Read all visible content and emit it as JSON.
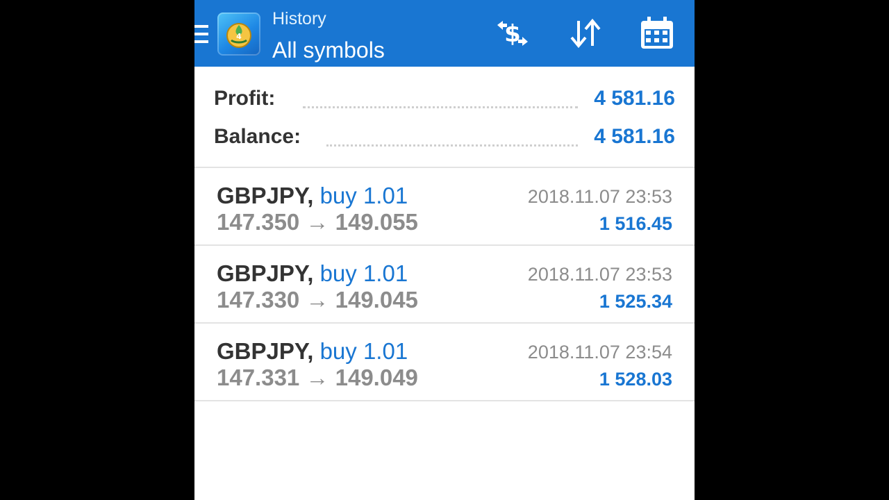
{
  "header": {
    "subtitle": "History",
    "title": "All symbols",
    "background_color": "#1976d2",
    "actions": [
      {
        "icon": "currency-exchange-icon"
      },
      {
        "icon": "sort-icon"
      },
      {
        "icon": "calendar-icon"
      }
    ]
  },
  "summary": {
    "profit_label": "Profit:",
    "profit_value": "4 581.16",
    "balance_label": "Balance:",
    "balance_value": "4 581.16"
  },
  "deals": [
    {
      "symbol": "GBPJPY",
      "separator": ",",
      "type": "buy 1.01",
      "prices": "147.350 → 149.055",
      "time": "2018.11.07 23:53",
      "profit": "1 516.45"
    },
    {
      "symbol": "GBPJPY",
      "separator": ",",
      "type": "buy 1.01",
      "prices": "147.330 → 149.045",
      "time": "2018.11.07 23:53",
      "profit": "1 525.34"
    },
    {
      "symbol": "GBPJPY",
      "separator": ",",
      "type": "buy 1.01",
      "prices": "147.331 → 149.049",
      "time": "2018.11.07 23:54",
      "profit": "1 528.03"
    }
  ],
  "colors": {
    "accent": "#1976d2",
    "text_primary": "#333333",
    "text_secondary": "#8c8c8c",
    "divider": "#e3e3e3"
  }
}
